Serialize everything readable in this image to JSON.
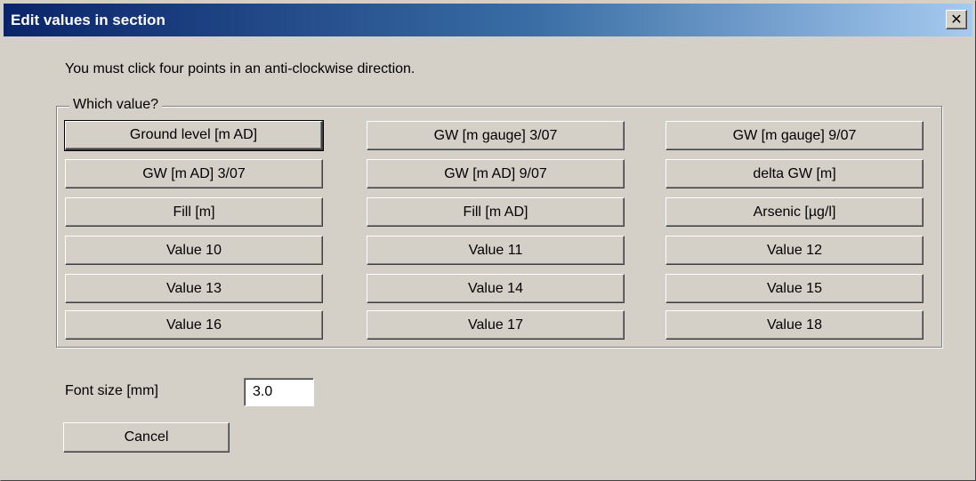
{
  "window": {
    "title": "Edit values in section",
    "close_glyph": "✕"
  },
  "instruction": "You must click four points in an anti-clockwise direction.",
  "group": {
    "legend": "Which value?",
    "buttons": [
      [
        "Ground level [m AD]",
        "GW [m gauge] 3/07",
        "GW [m gauge] 9/07"
      ],
      [
        "GW [m AD] 3/07",
        "GW [m AD] 9/07",
        "delta GW [m]"
      ],
      [
        "Fill [m]",
        "Fill [m AD]",
        "Arsenic [µg/l]"
      ],
      [
        "Value 10",
        "Value 11",
        "Value 12"
      ],
      [
        "Value 13",
        "Value 14",
        "Value 15"
      ],
      [
        "Value 16",
        "Value 17",
        "Value 18"
      ]
    ]
  },
  "font_size": {
    "label": "Font size [mm]",
    "value": "3.0"
  },
  "cancel_label": "Cancel"
}
